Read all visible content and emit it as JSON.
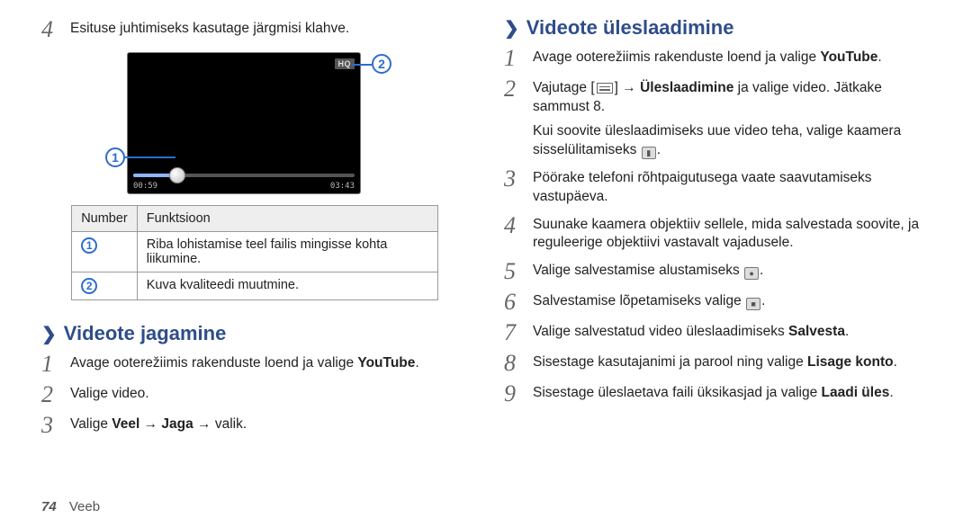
{
  "left": {
    "step4": "Esituse juhtimiseks kasutage järgmisi klahve.",
    "video": {
      "hq": "HQ",
      "time_left": "00:59",
      "time_right": "03:43"
    },
    "table": {
      "head_number": "Number",
      "head_function": "Funktsioon",
      "rows": [
        {
          "num": "1",
          "desc": "Riba lohistamise teel failis mingisse kohta liikumine."
        },
        {
          "num": "2",
          "desc": "Kuva kvaliteedi muutmine."
        }
      ]
    },
    "share_heading": "Videote jagamine",
    "share_steps": {
      "s1_pre": "Avage ooterežiimis rakenduste loend ja valige ",
      "s1_bold": "YouTube",
      "s1_post": ".",
      "s2": "Valige video.",
      "s3_pre": "Valige ",
      "s3_b1": "Veel",
      "s3_mid1": " → ",
      "s3_b2": "Jaga",
      "s3_mid2": " → valik."
    }
  },
  "right": {
    "upload_heading": "Videote üleslaadimine",
    "s1_pre": "Avage ooterežiimis rakenduste loend ja valige ",
    "s1_bold": "YouTube",
    "s1_post": ".",
    "s2_pre": "Vajutage [",
    "s2_mid": "] → ",
    "s2_b1": "Üleslaadimine",
    "s2_post": " ja valige video. Jätkake sammust 8.",
    "s2_extra": "Kui soovite üleslaadimiseks uue video teha, valige kaamera sisselülitamiseks ",
    "s2_extra_post": ".",
    "s3": "Pöörake telefoni rõhtpaigutusega vaate saavutamiseks vastupäeva.",
    "s4": "Suunake kaamera objektiiv sellele, mida salvestada soovite, ja reguleerige objektiivi vastavalt vajadusele.",
    "s5_pre": "Valige salvestamise alustamiseks ",
    "s5_post": ".",
    "s6_pre": "Salvestamise lõpetamiseks valige ",
    "s6_post": ".",
    "s7_pre": "Valige salvestatud video üleslaadimiseks ",
    "s7_bold": "Salvesta",
    "s7_post": ".",
    "s8_pre": "Sisestage kasutajanimi ja parool ning valige ",
    "s8_bold": "Lisage konto",
    "s8_post": ".",
    "s9_pre": "Sisestage üleslaetava faili üksikasjad ja valige ",
    "s9_bold": "Laadi üles",
    "s9_post": "."
  },
  "footer": {
    "page": "74",
    "section": "Veeb"
  }
}
